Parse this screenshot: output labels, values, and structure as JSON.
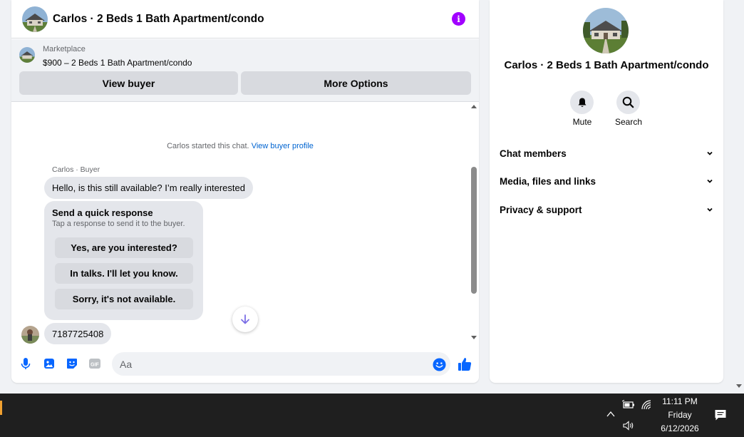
{
  "chat": {
    "title": "Carlos · 2 Beds 1 Bath Apartment/condo",
    "listing": {
      "category": "Marketplace",
      "summary": "$900 – 2 Beds 1 Bath Apartment/condo",
      "view_buyer_label": "View buyer",
      "more_options_label": "More Options"
    },
    "system_note": "Carlos started this chat.",
    "system_link": "View buyer profile",
    "sender_label": "Carlos · Buyer",
    "message_1": "Hello, is this still available? I’m really interested",
    "quick_response": {
      "title": "Send a quick response",
      "subtitle": "Tap a response to send it to the buyer.",
      "options": [
        "Yes, are you interested?",
        "In talks. I'll let you know.",
        "Sorry, it's not available."
      ]
    },
    "message_2": "7187725408",
    "composer_placeholder": "Aa"
  },
  "details": {
    "title": "Carlos · 2 Beds 1 Bath Apartment/condo",
    "actions": {
      "mute": "Mute",
      "search": "Search"
    },
    "sections": [
      "Chat members",
      "Media, files and links",
      "Privacy & support"
    ]
  },
  "taskbar": {
    "time": "11:11 PM",
    "day": "Friday",
    "date": "6/12/2026"
  },
  "colors": {
    "accent": "#0866ff",
    "info": "#a100ff",
    "link": "#0064d1"
  },
  "icons": [
    "info-icon",
    "mic-icon",
    "photo-icon",
    "sticker-icon",
    "gif-icon",
    "emoji-icon",
    "like-icon",
    "bell-icon",
    "search-icon",
    "chevron-down-icon",
    "arrow-down-icon"
  ]
}
